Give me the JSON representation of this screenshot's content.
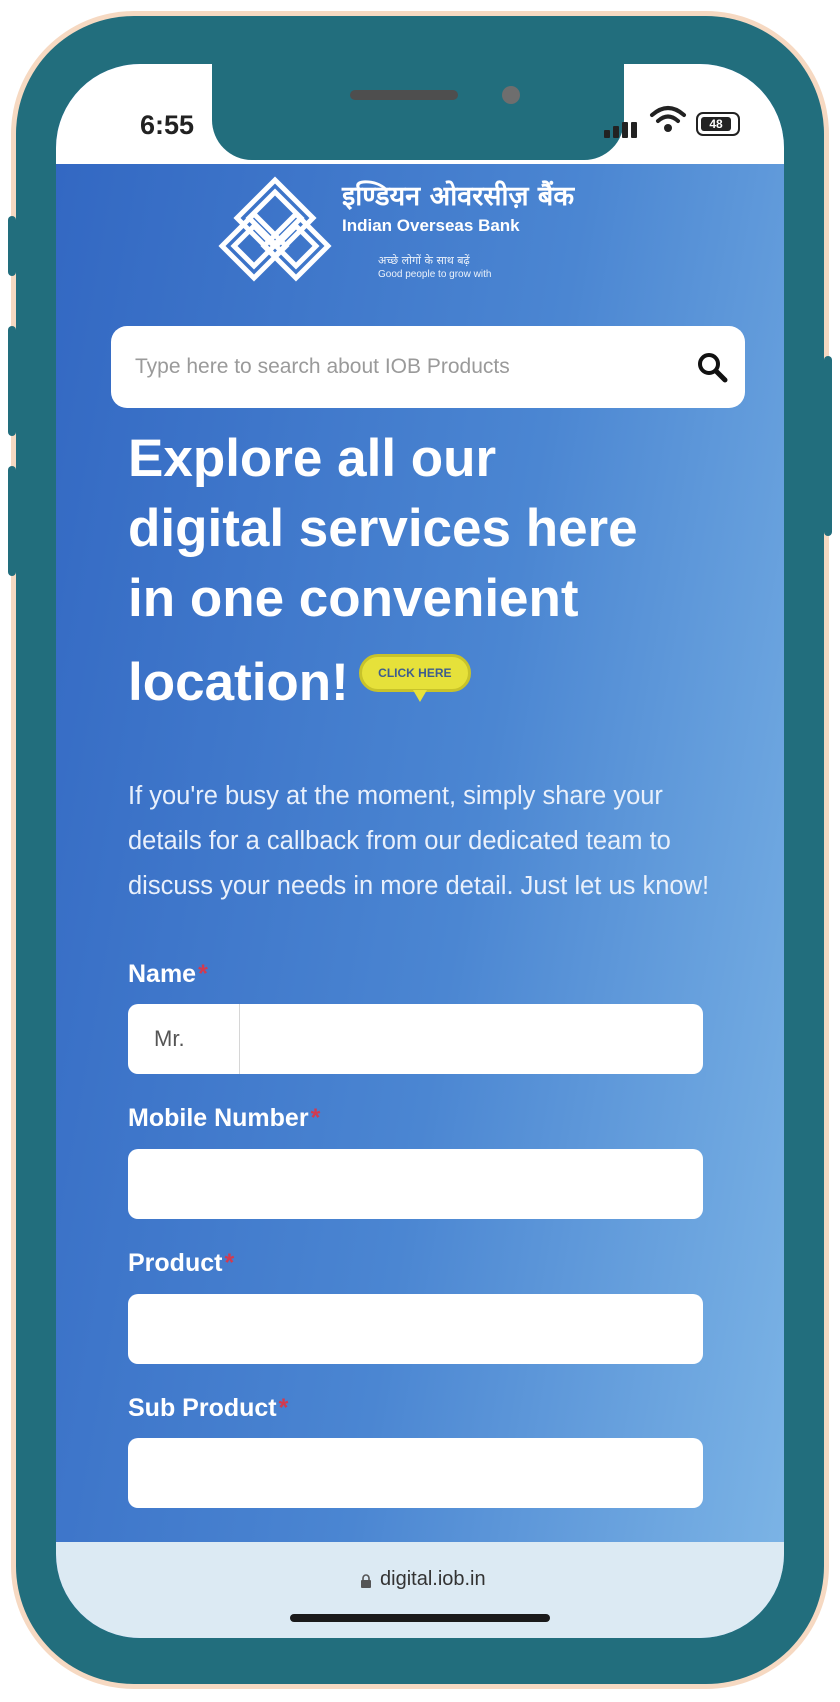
{
  "status_bar": {
    "time": "6:55",
    "battery": "48"
  },
  "brand": {
    "name_hindi": "इण्डियन ओवरसीज़ बैंक",
    "name_english": "Indian Overseas Bank",
    "tagline_hindi": "अच्छे लोगों के साथ बढ़ें",
    "tagline_english": "Good people to grow with"
  },
  "search": {
    "placeholder": "Type here to search about IOB Products",
    "icon": "search-icon"
  },
  "hero": {
    "line1": "Explore all our",
    "line2": "digital services here",
    "line3": "in one convenient",
    "line4": "location!",
    "cta_label": "CLICK HERE"
  },
  "intro_text": "If you're busy at the moment, simply share your details for a callback from our dedicated team to discuss your needs in more detail. Just let us know!",
  "form": {
    "required_marker": "*",
    "name_label": "Name",
    "salutation": "Mr.",
    "mobile_label": "Mobile Number",
    "product_label": "Product",
    "sub_product_label": "Sub Product"
  },
  "browser": {
    "url": "digital.iob.in"
  },
  "colors": {
    "frame": "#226e7d",
    "gradient_start": "#3267c2",
    "gradient_end": "#7db5e6",
    "cta_yellow": "#e6e13a",
    "required_red": "#d33a4f"
  }
}
